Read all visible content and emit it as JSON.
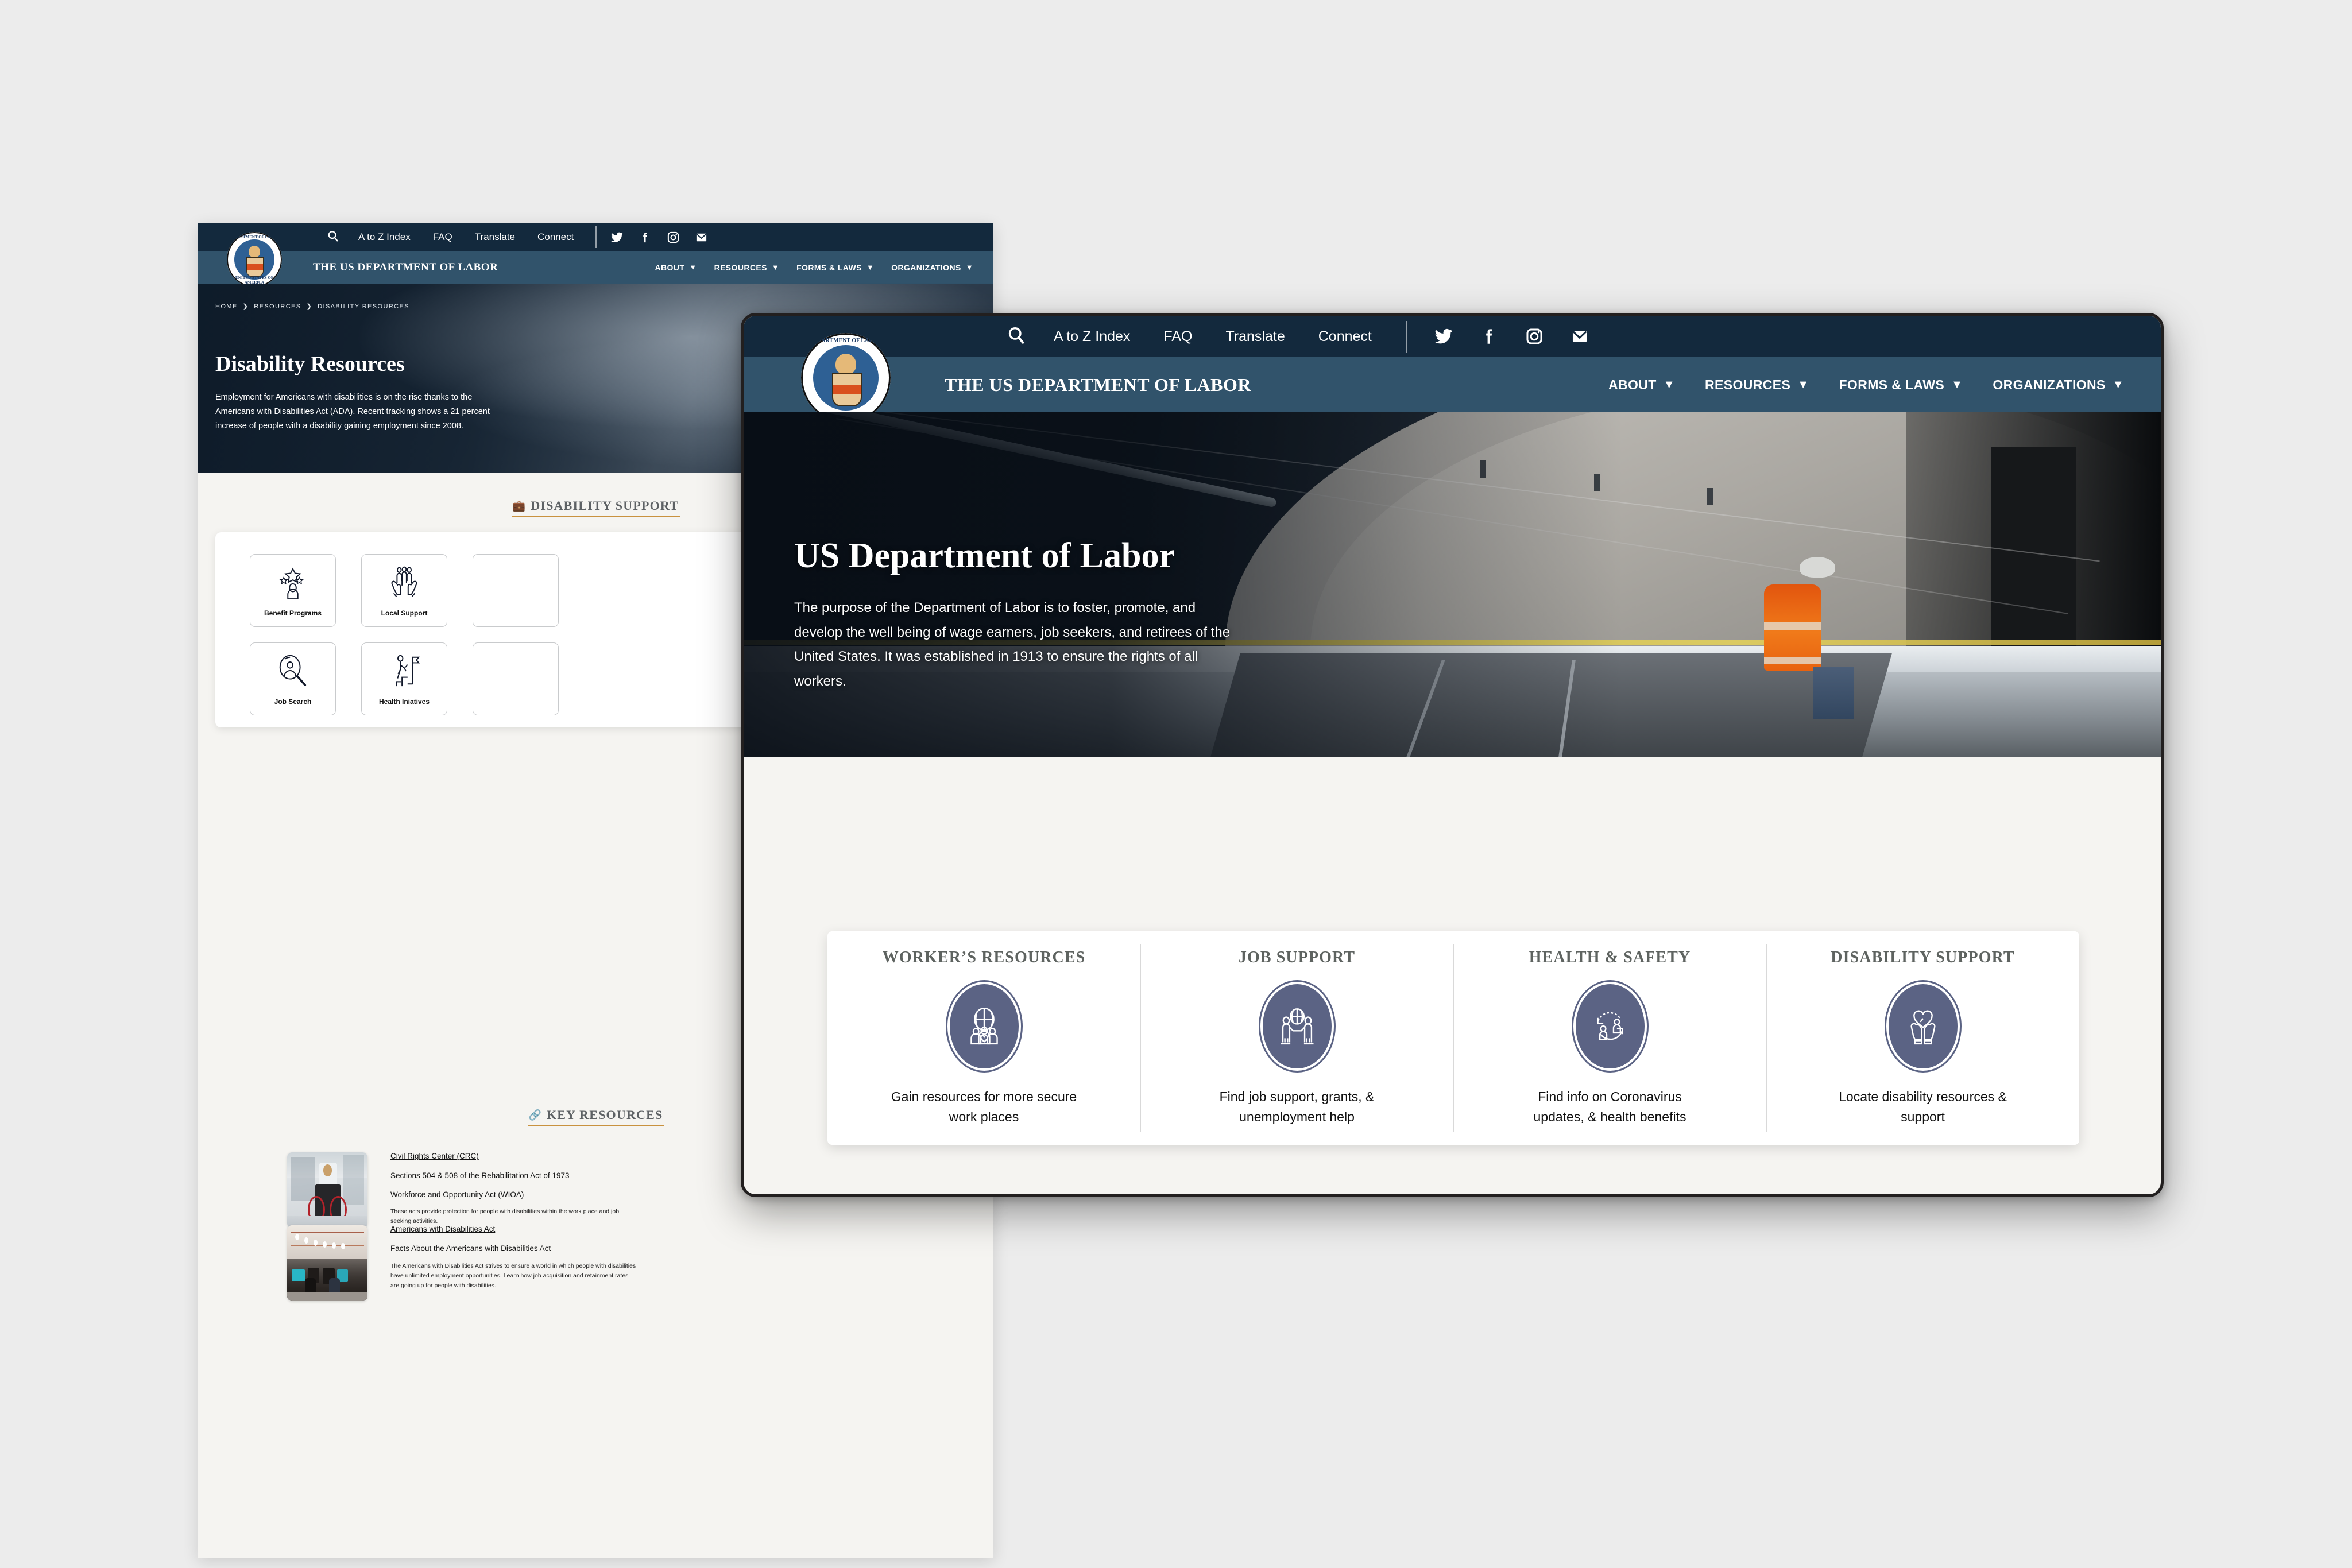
{
  "background_color": "#ececec",
  "colors": {
    "utility_bar": "#13293d",
    "main_nav": "#31536b",
    "gold_accent": "#c9923f",
    "badge_navy": "#5b6384",
    "page_bg": "#f5f4f1"
  },
  "back_window": {
    "utility": {
      "search_icon": "search-icon",
      "links": [
        "A to Z Index",
        "FAQ",
        "Translate",
        "Connect"
      ],
      "social": [
        "twitter-icon",
        "facebook-icon",
        "instagram-icon",
        "email-icon"
      ]
    },
    "brand": "THE US DEPARTMENT OF LABOR",
    "nav": [
      "ABOUT",
      "RESOURCES",
      "FORMS & LAWS",
      "ORGANIZATIONS"
    ],
    "breadcrumb": [
      "HOME",
      "RESOURCES",
      "DISABILITY RESOURCES"
    ],
    "hero": {
      "title": "Disability Resources",
      "body": "Employment for Americans with disabilities is on the rise thanks to the Americans with Disabilities Act (ADA). Recent tracking shows a 21 percent increase of people with a disability gaining employment since 2008."
    },
    "section_disability": {
      "icon": "briefcase-icon",
      "title": "DISABILITY SUPPORT",
      "tiles": [
        {
          "label": "Benefit Programs",
          "icon": "person-stars-icon"
        },
        {
          "label": "Local Support",
          "icon": "hands-people-icon"
        },
        {
          "label": "",
          "icon": "cut-off-icon"
        },
        {
          "label": "Job Search",
          "icon": "magnifier-person-icon"
        },
        {
          "label": "Health Iniatives",
          "icon": "person-stairs-flag-icon"
        },
        {
          "label": "",
          "icon": "cut-off-icon"
        }
      ]
    },
    "section_key_resources": {
      "icon": "link-icon",
      "title": "KEY RESOURCES",
      "rows": [
        {
          "thumb": "wheelchair-hallway-photo",
          "links": [
            "Civil Rights Center (CRC)",
            "Sections 504 & 508 of the Rehabilitation Act of 1973",
            "Workforce and Opportunity Act (WIOA)"
          ],
          "description": "These acts provide protection for people with disabilities within the work place and job seeking activities."
        },
        {
          "thumb": "open-office-photo",
          "links": [
            "Americans with Disabilities Act",
            "Facts About the Americans with Disabilities Act"
          ],
          "description": "The Americans with Disabilities Act strives to ensure a world in which people with disabilities have unlimited employment opportunities. Learn how job acquisition and retainment rates are going up for people with disabilities."
        }
      ]
    }
  },
  "front_window": {
    "utility": {
      "search_icon": "search-icon",
      "links": [
        "A to Z Index",
        "FAQ",
        "Translate",
        "Connect"
      ],
      "social": [
        "twitter-icon",
        "facebook-icon",
        "instagram-icon",
        "email-icon"
      ]
    },
    "brand": "THE US DEPARTMENT OF LABOR",
    "nav": [
      "ABOUT",
      "RESOURCES",
      "FORMS & LAWS",
      "ORGANIZATIONS"
    ],
    "hero": {
      "image": "tunnel-construction-worker-photo",
      "title": "US Department of Labor",
      "body": "The purpose of the Department of Labor is to foster, promote, and develop the well being of wage earners, job seekers, and retirees of the United States. It was established in 1913 to ensure the rights of all workers."
    },
    "features": [
      {
        "title": "WORKER’S RESOURCES",
        "icon": "globe-people-heart-icon",
        "desc": "Gain resources for more secure work places"
      },
      {
        "title": "JOB SUPPORT",
        "icon": "handshake-globe-icon",
        "desc": "Find job support, grants, & unemployment help"
      },
      {
        "title": "HEALTH & SAFETY",
        "icon": "cycle-people-icon",
        "desc": "Find info on Coronavirus updates, & health benefits"
      },
      {
        "title": "DISABILITY SUPPORT",
        "icon": "hands-heart-icon",
        "desc": "Locate disability resources & support"
      }
    ]
  }
}
